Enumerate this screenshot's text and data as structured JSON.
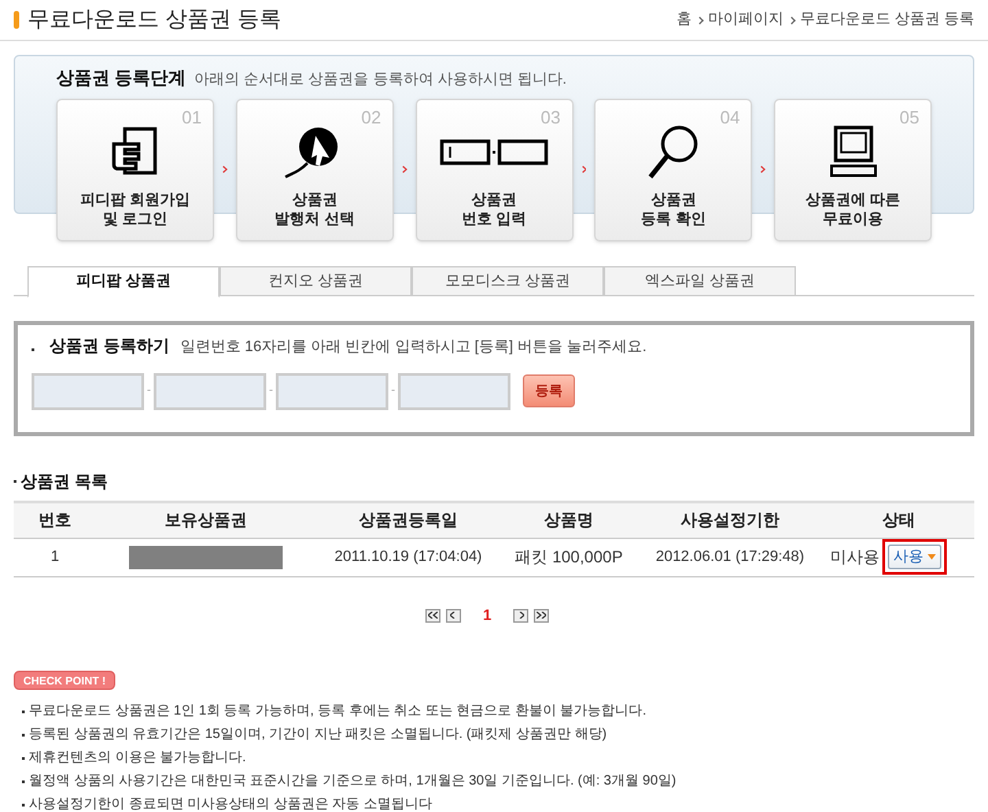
{
  "page_title": "무료다운로드 상품권 등록",
  "breadcrumb": [
    "홈",
    "마이페이지",
    "무료다운로드 상품권 등록"
  ],
  "steps_panel": {
    "title": "상품권 등록단계",
    "description": "아래의 순서대로 상품권을 등록하여 사용하시면 됩니다.",
    "steps": [
      {
        "number": "01",
        "kind": "hand",
        "lines": [
          "피디팝 회원가입",
          "및 로그인"
        ]
      },
      {
        "number": "02",
        "kind": "cursor",
        "lines": [
          "상품권",
          "발행처 선택"
        ]
      },
      {
        "number": "03",
        "kind": "fields",
        "lines": [
          "상품권",
          "번호 입력"
        ]
      },
      {
        "number": "04",
        "kind": "magnifier",
        "lines": [
          "상품권",
          "등록 확인"
        ]
      },
      {
        "number": "05",
        "kind": "computer",
        "lines": [
          "상품권에 따른",
          "무료이용"
        ]
      }
    ]
  },
  "tabs": [
    {
      "label": "피디팝 상품권",
      "selected": true
    },
    {
      "label": "컨지오 상품권",
      "selected": false
    },
    {
      "label": "모모디스크 상품권",
      "selected": false
    },
    {
      "label": "엑스파일 상품권",
      "selected": false
    }
  ],
  "register": {
    "title": "상품권 등록하기",
    "instruction": "일련번호 16자리를 아래 빈칸에 입력하시고 [등록] 버튼을 눌러주세요.",
    "field_count_separator": "-",
    "button": "등록"
  },
  "list": {
    "title": "상품권 목록",
    "columns": [
      "번호",
      "보유상품권",
      "상품권등록일",
      "상품명",
      "사용설정기한",
      "상태"
    ],
    "rows": [
      {
        "number": "1",
        "redacted": true,
        "registered": "2011.10.19 (17:04:04)",
        "product": "패킷 100,000P",
        "deadline": "2012.06.01 (17:29:48)",
        "status": "미사용",
        "action": "사용",
        "highlighted": true
      }
    ]
  },
  "pagination": {
    "pages": [
      {
        "label": "1",
        "selected": true
      }
    ]
  },
  "checkpoint": {
    "badge": "CHECK POINT !",
    "notes": [
      "무료다운로드 상품권은 1인 1회 등록 가능하며, 등록 후에는 취소 또는 현금으로 환불이 불가능합니다.",
      "등록된 상품권의 유효기간은 15일이며, 기간이 지난 패킷은 소멸됩니다. (패킷제 상품권만 해당)",
      "제휴컨텐츠의 이용은 불가능합니다.",
      "월정액 상품의 사용기간은 대한민국 표준시간을 기준으로 하며, 1개월은 30일 기준입니다. (예: 3개월 90일)",
      "사용설정기한이 종료되면 미사용상태의 상품권은 자동 소멸됩니다"
    ]
  }
}
